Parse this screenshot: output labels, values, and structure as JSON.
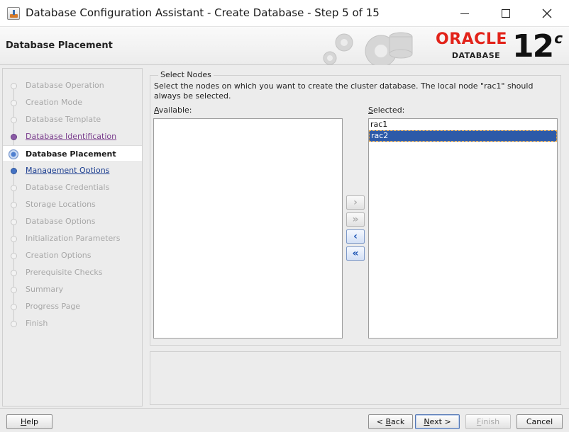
{
  "window": {
    "title": "Database Configuration Assistant - Create Database - Step 5 of 15"
  },
  "header": {
    "heading": "Database Placement",
    "logo_word": "ORACLE",
    "logo_sub": "DATABASE",
    "version_number": "12",
    "version_suffix": "c"
  },
  "nav": {
    "items": [
      {
        "label": "Database Operation",
        "state": "disabled"
      },
      {
        "label": "Creation Mode",
        "state": "disabled"
      },
      {
        "label": "Database Template",
        "state": "disabled"
      },
      {
        "label": "Database Identification",
        "state": "visited"
      },
      {
        "label": "Database Placement",
        "state": "current"
      },
      {
        "label": "Management Options",
        "state": "next"
      },
      {
        "label": "Database Credentials",
        "state": "disabled"
      },
      {
        "label": "Storage Locations",
        "state": "disabled"
      },
      {
        "label": "Database Options",
        "state": "disabled"
      },
      {
        "label": "Initialization Parameters",
        "state": "disabled"
      },
      {
        "label": "Creation Options",
        "state": "disabled"
      },
      {
        "label": "Prerequisite Checks",
        "state": "disabled"
      },
      {
        "label": "Summary",
        "state": "disabled"
      },
      {
        "label": "Progress Page",
        "state": "disabled"
      },
      {
        "label": "Finish",
        "state": "disabled"
      }
    ]
  },
  "content": {
    "group_title": "Select Nodes",
    "instructions": "Select the nodes on which you want to create the cluster database. The local node \"rac1\" should always be selected.",
    "available_label_mnemonic": "A",
    "available_label_rest": "vailable:",
    "selected_label_mnemonic": "S",
    "selected_label_rest": "elected:",
    "available_items": [],
    "selected_items": [
      "rac1",
      "rac2"
    ],
    "highlighted_item": "rac2",
    "move_buttons": [
      {
        "symbol": "›",
        "name": "move-selected",
        "enabled": false
      },
      {
        "symbol": "»",
        "name": "move-all",
        "enabled": false
      },
      {
        "symbol": "‹",
        "name": "remove-selected",
        "enabled": true
      },
      {
        "symbol": "«",
        "name": "remove-all",
        "enabled": true
      }
    ]
  },
  "footer": {
    "help_mnemonic": "H",
    "help_rest": "elp",
    "back_prefix": "< ",
    "back_mnemonic": "B",
    "back_rest": "ack",
    "next_mnemonic": "N",
    "next_rest": "ext >",
    "finish_mnemonic": "F",
    "finish_rest": "inish",
    "cancel_label": "Cancel"
  },
  "colors": {
    "oracle_red": "#e2231a",
    "selection_blue": "#2d5aa8",
    "visited_purple": "#7b3e8e",
    "link_blue": "#1a3c8f"
  }
}
